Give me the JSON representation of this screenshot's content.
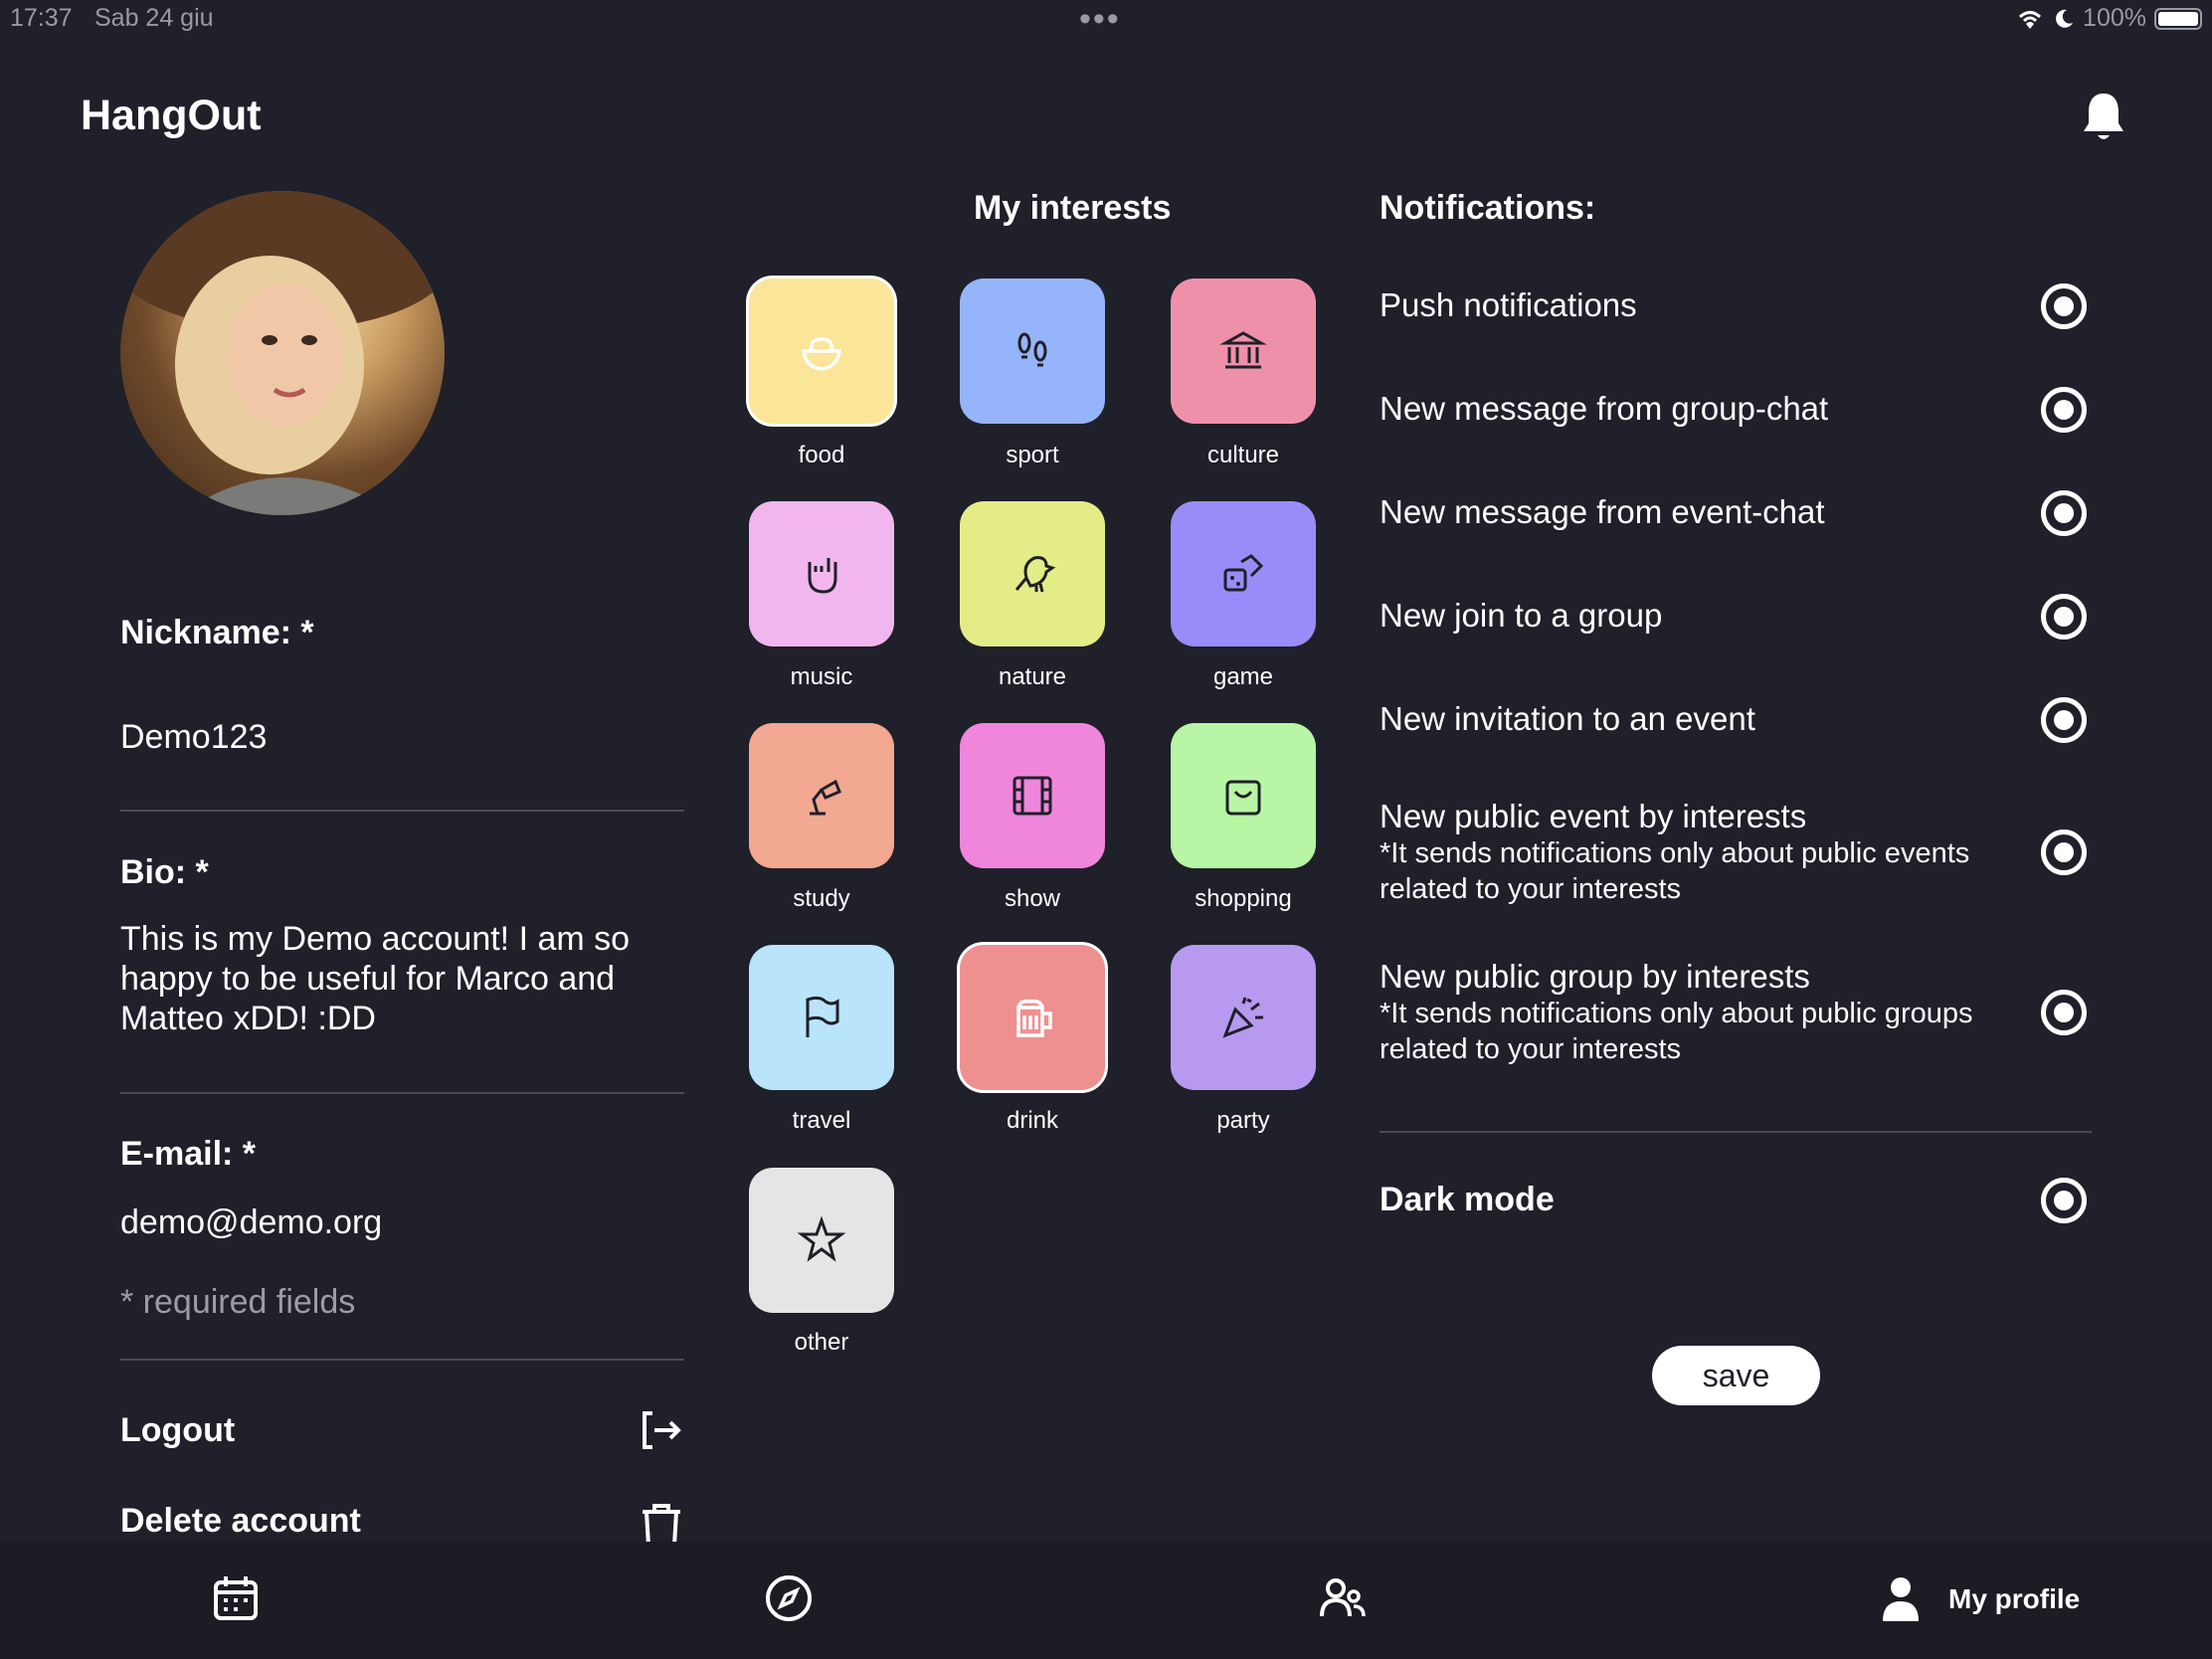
{
  "status_bar": {
    "time": "17:37",
    "date": "Sab 24 giu",
    "dots": "•••",
    "battery": "100%"
  },
  "app": {
    "title": "HangOut"
  },
  "profile": {
    "nickname_label": "Nickname: *",
    "nickname_value": "Demo123",
    "bio_label": "Bio: *",
    "bio_value": "This is my Demo account! I am so happy to be useful for Marco and Matteo xDD! :DD",
    "email_label": "E-mail: *",
    "email_value": "demo@demo.org",
    "required_note": "* required fields",
    "logout_label": "Logout",
    "delete_label": "Delete account"
  },
  "interests": {
    "title": "My interests",
    "items": [
      {
        "label": "food",
        "color": "#fbe598",
        "icon": "salad-bowl-icon",
        "selected": true
      },
      {
        "label": "sport",
        "color": "#96b4f9",
        "icon": "footprints-icon",
        "selected": false
      },
      {
        "label": "culture",
        "color": "#ef90aa",
        "icon": "museum-icon",
        "selected": false
      },
      {
        "label": "music",
        "color": "#f2b6ee",
        "icon": "rock-hand-icon",
        "selected": false
      },
      {
        "label": "nature",
        "color": "#e4ec87",
        "icon": "bird-icon",
        "selected": false
      },
      {
        "label": "game",
        "color": "#9a8cf8",
        "icon": "dice-icon",
        "selected": false
      },
      {
        "label": "study",
        "color": "#f2a891",
        "icon": "desk-lamp-icon",
        "selected": false
      },
      {
        "label": "show",
        "color": "#ef86dc",
        "icon": "film-icon",
        "selected": false
      },
      {
        "label": "shopping",
        "color": "#b8f5a4",
        "icon": "shopping-bag-icon",
        "selected": false
      },
      {
        "label": "travel",
        "color": "#b9e4fa",
        "icon": "flag-icon",
        "selected": false
      },
      {
        "label": "drink",
        "color": "#ef9090",
        "icon": "beer-icon",
        "selected": true
      },
      {
        "label": "party",
        "color": "#b79af0",
        "icon": "party-popper-icon",
        "selected": false
      },
      {
        "label": "other",
        "color": "#e5e5e5",
        "icon": "star-icon",
        "selected": false
      }
    ]
  },
  "notifications": {
    "title": "Notifications:",
    "push": "Push notifications",
    "group_chat": "New message from group-chat",
    "event_chat": "New message from event-chat",
    "join_group": "New join to a group",
    "invitation": "New invitation to an event",
    "public_event": "New public event by interests",
    "public_event_note": "*It sends notifications only about public events related to your interests",
    "public_group": "New public group by interests",
    "public_group_note": "*It sends notifications only about public groups related to your interests",
    "dark_mode": "Dark mode",
    "save": "save"
  },
  "nav": {
    "calendar": "calendar-icon",
    "explore": "compass-icon",
    "groups": "users-icon",
    "profile_label": "My profile"
  }
}
